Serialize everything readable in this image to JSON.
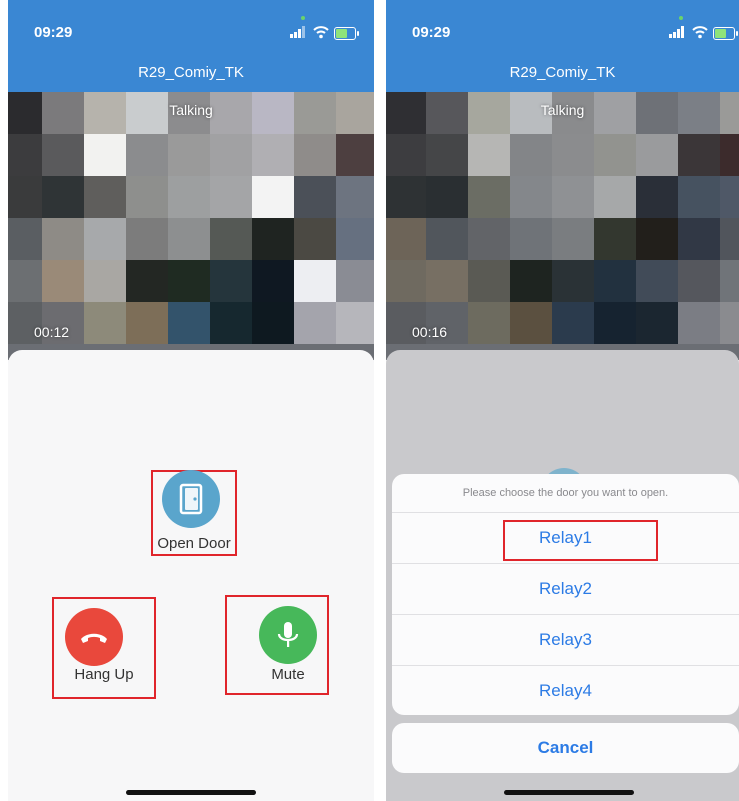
{
  "status_bar": {
    "time": "09:29"
  },
  "header": {
    "device_name": "R29_Comiy_TK"
  },
  "video": {
    "status": "Talking"
  },
  "left_screen": {
    "timer": "00:12",
    "actions": {
      "open_door": "Open Door",
      "hang_up": "Hang Up",
      "mute": "Mute"
    }
  },
  "right_screen": {
    "timer": "00:16",
    "door_sheet": {
      "title": "Please choose the door you want to open.",
      "options": [
        "Relay1",
        "Relay2",
        "Relay3",
        "Relay4"
      ],
      "cancel": "Cancel"
    }
  },
  "colors": {
    "header_blue": "#3a87d3",
    "open_door_blue": "#5aa5cc",
    "hang_up_red": "#e9483c",
    "mute_green": "#47b85a",
    "relay_blue": "#2c7be5",
    "highlight_red": "#e0252b"
  },
  "icons": {
    "open_door": "door-icon",
    "hang_up": "phone-hangup-icon",
    "mute": "microphone-icon"
  }
}
